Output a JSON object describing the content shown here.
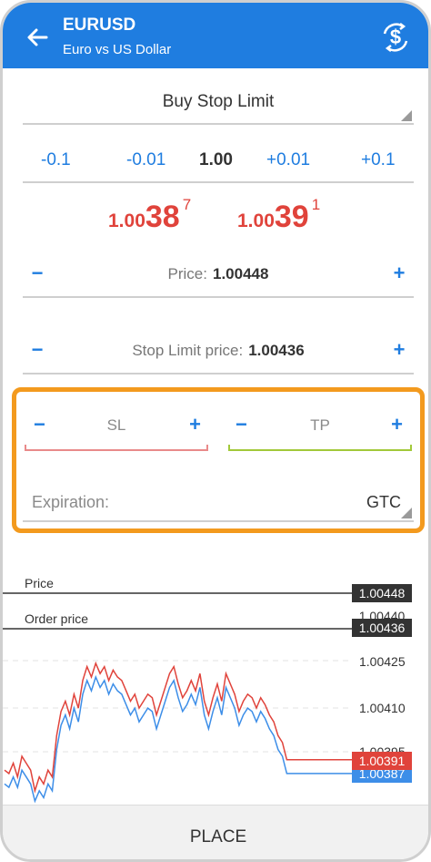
{
  "header": {
    "symbol": "EURUSD",
    "description": "Euro vs US Dollar"
  },
  "order_type": "Buy Stop Limit",
  "volume": {
    "dec_01": "-0.1",
    "dec_001": "-0.01",
    "value": "1.00",
    "inc_001": "+0.01",
    "inc_01": "+0.1"
  },
  "quotes": {
    "bid": {
      "prefix": "1.00",
      "big": "38",
      "sup": "7"
    },
    "ask": {
      "prefix": "1.00",
      "big": "39",
      "sup": "1"
    }
  },
  "price": {
    "label": "Price:",
    "value": "1.00448",
    "minus": "−",
    "plus": "+"
  },
  "stop_limit": {
    "label": "Stop Limit price:",
    "value": "1.00436",
    "minus": "−",
    "plus": "+"
  },
  "sl": {
    "label": "SL",
    "minus": "−",
    "plus": "+"
  },
  "tp": {
    "label": "TP",
    "minus": "−",
    "plus": "+"
  },
  "expiration": {
    "label": "Expiration:",
    "value": "GTC"
  },
  "chart_labels": {
    "price_line": "Price",
    "order_line": "Order price",
    "price_tag": "1.00448",
    "order_tag": "1.00436",
    "hidden_tag": "1.00440",
    "tick_1": "1.00425",
    "tick_2": "1.00410",
    "bid_tag": "1.00391",
    "ask_tag": "1.00387",
    "hidden_tick": "1.00395"
  },
  "colors": {
    "accent": "#1f7de0",
    "quote_red": "#e0433b",
    "highlight_orange": "#f39a1e",
    "sl_line": "#e98a8a",
    "tp_line": "#a2c93a"
  },
  "chart_data": {
    "type": "line",
    "y_range": [
      1.00378,
      1.00452
    ],
    "series": [
      {
        "values": [
          1.00388,
          1.00387,
          1.0039,
          1.00386,
          1.00392,
          1.0039,
          1.00388,
          1.00382,
          1.00386,
          1.00384,
          1.00388,
          1.00386,
          1.00398,
          1.00405,
          1.00408,
          1.00404,
          1.0041,
          1.00406,
          1.00414,
          1.00418,
          1.00415,
          1.00419,
          1.00416,
          1.00418,
          1.00414,
          1.00417,
          1.00415,
          1.00414,
          1.00411,
          1.00408,
          1.0041,
          1.00406,
          1.00408,
          1.0041,
          1.00409,
          1.00404,
          1.00408,
          1.00412,
          1.00416,
          1.00418,
          1.00413,
          1.00409,
          1.00411,
          1.00414,
          1.00411,
          1.00416,
          1.00408,
          1.00404,
          1.00409,
          1.00413,
          1.00408,
          1.00416,
          1.00413,
          1.0041,
          1.00405,
          1.00408,
          1.0041,
          1.00409,
          1.00406,
          1.00409,
          1.00407,
          1.00404,
          1.00402,
          1.00398,
          1.00396,
          1.00391,
          1.00391,
          1.00391,
          1.00391,
          1.00391,
          1.00391,
          1.00391,
          1.00391,
          1.00391,
          1.00391,
          1.00391,
          1.00391,
          1.00391,
          1.00391,
          1.00391,
          1.00391
        ]
      },
      {
        "values": [
          1.00384,
          1.00383,
          1.00386,
          1.00383,
          1.00388,
          1.00386,
          1.00384,
          1.00379,
          1.00382,
          1.0038,
          1.00384,
          1.00382,
          1.00394,
          1.00401,
          1.00404,
          1.004,
          1.00406,
          1.00402,
          1.0041,
          1.00414,
          1.00411,
          1.00415,
          1.00412,
          1.00414,
          1.0041,
          1.00413,
          1.00411,
          1.0041,
          1.00407,
          1.00404,
          1.00406,
          1.00402,
          1.00404,
          1.00406,
          1.00405,
          1.004,
          1.00404,
          1.00408,
          1.00412,
          1.00414,
          1.00409,
          1.00405,
          1.00407,
          1.0041,
          1.00407,
          1.00412,
          1.00404,
          1.004,
          1.00405,
          1.00409,
          1.00404,
          1.00412,
          1.00409,
          1.00406,
          1.00401,
          1.00404,
          1.00406,
          1.00405,
          1.00402,
          1.00405,
          1.00403,
          1.004,
          1.00398,
          1.00394,
          1.00392,
          1.00387,
          1.00387,
          1.00387,
          1.00387,
          1.00387,
          1.00387,
          1.00387,
          1.00387,
          1.00387,
          1.00387,
          1.00387,
          1.00387,
          1.00387,
          1.00387,
          1.00387,
          1.00387
        ]
      }
    ]
  }
}
